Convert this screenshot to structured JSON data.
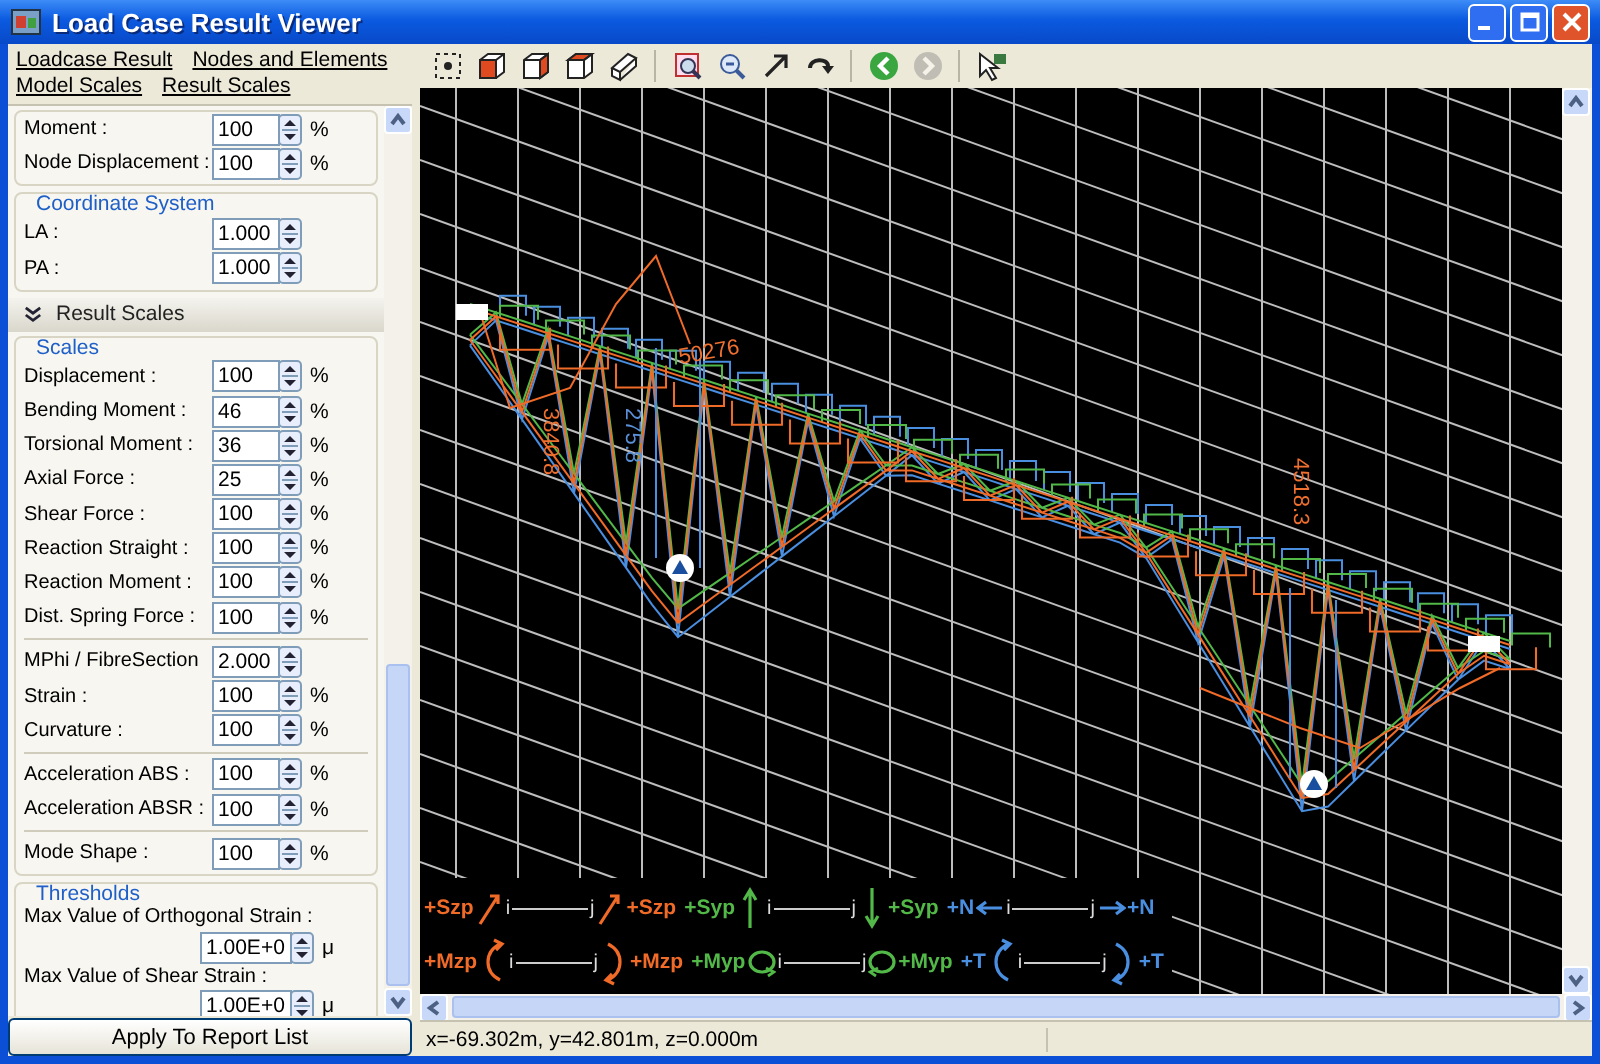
{
  "window": {
    "title": "Load Case Result Viewer"
  },
  "menu": [
    {
      "label": "Loadcase Result"
    },
    {
      "label": "Nodes and Elements"
    },
    {
      "label": "Model Scales"
    },
    {
      "label": "Result Scales"
    }
  ],
  "panel": [
    {
      "kind": "group",
      "rows": [
        {
          "kind": "inline",
          "label": "Moment :",
          "value": "100",
          "unit": "%"
        },
        {
          "kind": "inline",
          "label": "Node Displacement :",
          "value": "100",
          "unit": "%"
        }
      ]
    },
    {
      "kind": "group",
      "title": "Coordinate System",
      "rows": [
        {
          "kind": "inline",
          "label": "LA :",
          "value": "1.000"
        },
        {
          "kind": "inline",
          "label": "PA :",
          "value": "1.000"
        }
      ]
    },
    {
      "kind": "section",
      "title": "Result Scales",
      "expanded": true
    },
    {
      "kind": "group",
      "title": "Scales",
      "sets": [
        [
          {
            "kind": "inline",
            "label": "Displacement :",
            "value": "100",
            "unit": "%"
          },
          {
            "kind": "inline",
            "label": "Bending Moment :",
            "value": "46",
            "unit": "%"
          },
          {
            "kind": "inline",
            "label": "Torsional Moment :",
            "value": "36",
            "unit": "%"
          },
          {
            "kind": "inline",
            "label": "Axial Force :",
            "value": "25",
            "unit": "%"
          },
          {
            "kind": "inline",
            "label": "Shear Force :",
            "value": "100",
            "unit": "%"
          },
          {
            "kind": "inline",
            "label": "Reaction Straight :",
            "value": "100",
            "unit": "%"
          },
          {
            "kind": "inline",
            "label": "Reaction Moment :",
            "value": "100",
            "unit": "%"
          },
          {
            "kind": "inline",
            "label": "Dist. Spring Force :",
            "value": "100",
            "unit": "%"
          }
        ],
        [
          {
            "kind": "inline",
            "label": "MPhi / FibreSection",
            "value": "2.000"
          },
          {
            "kind": "inline",
            "label": "Strain :",
            "value": "100",
            "unit": "%"
          },
          {
            "kind": "inline",
            "label": "Curvature :",
            "value": "100",
            "unit": "%"
          }
        ],
        [
          {
            "kind": "inline",
            "label": "Acceleration ABS :",
            "value": "100",
            "unit": "%"
          },
          {
            "kind": "inline",
            "label": "Acceleration ABSR :",
            "value": "100",
            "unit": "%"
          }
        ],
        [
          {
            "kind": "inline",
            "label": "Mode Shape :",
            "value": "100",
            "unit": "%"
          }
        ]
      ]
    },
    {
      "kind": "group",
      "title": "Thresholds",
      "rows": [
        {
          "kind": "stacked",
          "label": "Max Value of Orthogonal Strain :",
          "value": "1.00E+0",
          "unit": "μ"
        },
        {
          "kind": "stacked",
          "label": "Max Value of Shear Strain :",
          "value": "1.00E+0",
          "unit": "μ"
        }
      ]
    }
  ],
  "apply_button": "Apply To Report List",
  "toolbar": [
    {
      "kind": "select",
      "disabled": false
    },
    {
      "kind": "cube-front",
      "disabled": false
    },
    {
      "kind": "cube-side",
      "disabled": false
    },
    {
      "kind": "cube-top",
      "disabled": false
    },
    {
      "kind": "prism",
      "disabled": false
    },
    {
      "kind": "zoom-window",
      "disabled": false
    },
    {
      "kind": "zoom-out",
      "disabled": false
    },
    {
      "kind": "arrow",
      "disabled": false
    },
    {
      "kind": "rotate",
      "disabled": false
    },
    {
      "kind": "back",
      "disabled": false
    },
    {
      "kind": "forward",
      "disabled": true
    },
    {
      "kind": "pointer",
      "disabled": false
    }
  ],
  "result_labels": [
    {
      "text": "3840.8",
      "color": "#f07030"
    },
    {
      "text": "275.8",
      "color": "#5a90d8"
    },
    {
      "text": "50276",
      "color": "#f07030"
    },
    {
      "text": "4518.3",
      "color": "#f07030"
    }
  ],
  "legend": [
    {
      "kind": "shear-z",
      "left": "+Szp",
      "i": "i",
      "j": "j",
      "right": "+Szp",
      "color": "#f06a28"
    },
    {
      "kind": "shear-y",
      "left": "+Syp",
      "i": "i",
      "j": "j",
      "right": "+Syp",
      "color": "#52b848"
    },
    {
      "kind": "axial",
      "left": "+N",
      "i": "i",
      "j": "j",
      "right": "+N",
      "color": "#4a8ee0"
    },
    {
      "kind": "moment-z",
      "left": "+Mzp",
      "i": "i",
      "j": "j",
      "right": "+Mzp",
      "color": "#f06a28"
    },
    {
      "kind": "moment-y",
      "left": "+Myp",
      "i": "i",
      "j": "j",
      "right": "+Myp",
      "color": "#52b848"
    },
    {
      "kind": "torsion",
      "left": "+T",
      "i": "i",
      "j": "j",
      "right": "+T",
      "color": "#4a8ee0"
    }
  ],
  "status_bar": {
    "coordinates": "x=-69.302m, y=42.801m, z=0.000m"
  }
}
